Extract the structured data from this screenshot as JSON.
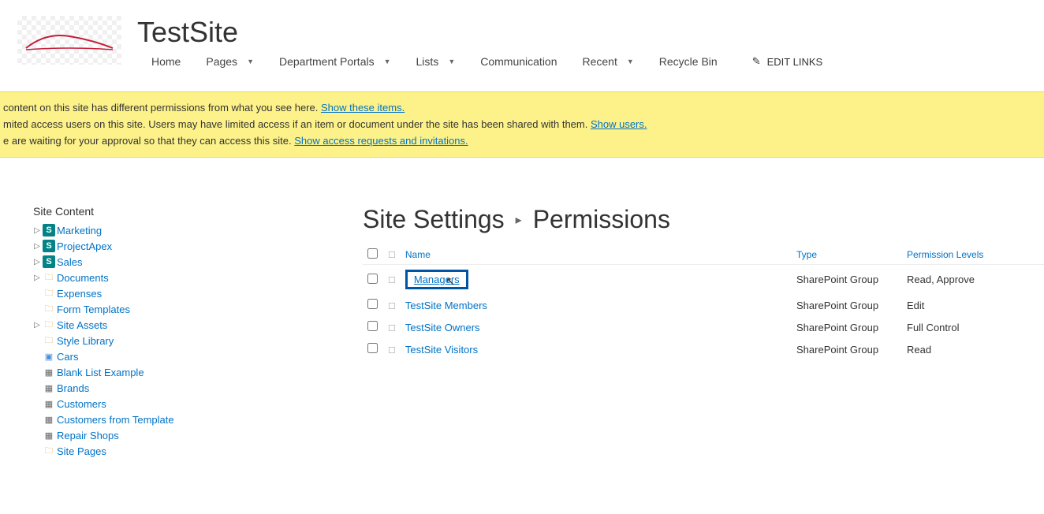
{
  "site": {
    "title": "TestSite"
  },
  "nav": {
    "items": [
      {
        "label": "Home",
        "has_dropdown": false
      },
      {
        "label": "Pages",
        "has_dropdown": true
      },
      {
        "label": "Department Portals",
        "has_dropdown": true
      },
      {
        "label": "Lists",
        "has_dropdown": true
      },
      {
        "label": "Communication",
        "has_dropdown": false
      },
      {
        "label": "Recent",
        "has_dropdown": true
      },
      {
        "label": "Recycle Bin",
        "has_dropdown": false
      }
    ],
    "edit_links": "EDIT LINKS"
  },
  "notifications": {
    "line1_prefix": " content on this site has different permissions from what you see here.  ",
    "line1_link": "Show these items.",
    "line2_prefix": "mited access users on this site. Users may have limited access if an item or document under the site has been shared with them. ",
    "line2_link": "Show users.",
    "line3_prefix": "e are waiting for your approval so that they can access this site. ",
    "line3_link": "Show access requests and invitations."
  },
  "sidebar": {
    "title": "Site Content",
    "items": [
      {
        "label": "Marketing",
        "icon": "site",
        "expandable": true
      },
      {
        "label": "ProjectApex",
        "icon": "site",
        "expandable": true
      },
      {
        "label": "Sales",
        "icon": "site",
        "expandable": true
      },
      {
        "label": "Documents",
        "icon": "folder",
        "expandable": true
      },
      {
        "label": "Expenses",
        "icon": "folder",
        "expandable": false
      },
      {
        "label": "Form Templates",
        "icon": "folder",
        "expandable": false
      },
      {
        "label": "Site Assets",
        "icon": "folder",
        "expandable": true
      },
      {
        "label": "Style Library",
        "icon": "folder",
        "expandable": false
      },
      {
        "label": "Cars",
        "icon": "image",
        "expandable": false
      },
      {
        "label": "Blank List Example",
        "icon": "list",
        "expandable": false
      },
      {
        "label": "Brands",
        "icon": "list",
        "expandable": false
      },
      {
        "label": "Customers",
        "icon": "list",
        "expandable": false
      },
      {
        "label": "Customers from Template",
        "icon": "list",
        "expandable": false
      },
      {
        "label": "Repair Shops",
        "icon": "list",
        "expandable": false
      },
      {
        "label": "Site Pages",
        "icon": "folder",
        "expandable": false
      }
    ]
  },
  "breadcrumb": {
    "part1": "Site Settings",
    "part2": "Permissions"
  },
  "permissions": {
    "headers": {
      "name": "Name",
      "type": "Type",
      "levels": "Permission Levels"
    },
    "rows": [
      {
        "name": "Managers",
        "type": "SharePoint Group",
        "levels": "Read, Approve",
        "highlighted": true
      },
      {
        "name": "TestSite Members",
        "type": "SharePoint Group",
        "levels": "Edit",
        "highlighted": false
      },
      {
        "name": "TestSite Owners",
        "type": "SharePoint Group",
        "levels": "Full Control",
        "highlighted": false
      },
      {
        "name": "TestSite Visitors",
        "type": "SharePoint Group",
        "levels": "Read",
        "highlighted": false
      }
    ]
  }
}
